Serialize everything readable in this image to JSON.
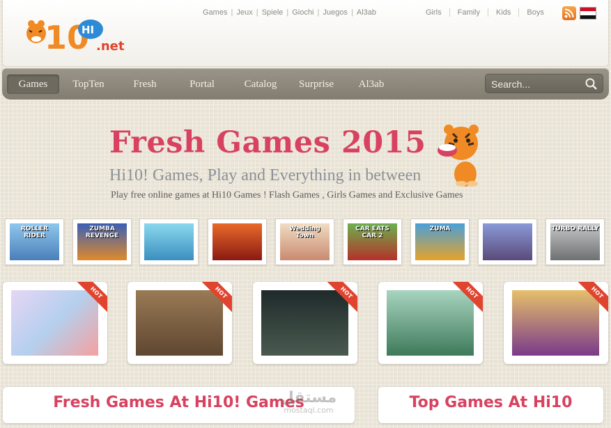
{
  "header": {
    "logo_text": "Hi10 HI .net",
    "languages": [
      "Games",
      "Jeux",
      "Spiele",
      "Giochi",
      "Juegos",
      "Al3ab"
    ],
    "categories": [
      "Girls",
      "Family",
      "Kids",
      "Boys"
    ],
    "rss_icon": "rss-icon",
    "flag_icon": "egypt-flag-icon"
  },
  "nav": {
    "items": [
      "Games",
      "TopTen",
      "Fresh",
      "Portal",
      "Catalog",
      "Surprise",
      "Al3ab"
    ],
    "active": "Games",
    "search_placeholder": "Search..."
  },
  "hero": {
    "title": "Fresh Games 2015",
    "subtitle": "Hi10! Games, Play and Everything in between",
    "description": "Play free online games at Hi10 Games ! Flash Games , Girls Games and Exclusive Games"
  },
  "thumbnails": [
    {
      "label": "ROLLER RIDER",
      "color": "#6aa7d8"
    },
    {
      "label": "ZUMBA REVENGE",
      "color": "#3a5fb5"
    },
    {
      "label": "",
      "color": "#68c4e0"
    },
    {
      "label": "",
      "color": "#c83b2a"
    },
    {
      "label": "Wedding Town",
      "color": "#e7c7a0"
    },
    {
      "label": "CAR EATS CAR 2",
      "color": "#4d8a3a"
    },
    {
      "label": "ZUMA",
      "color": "#2b6fb2"
    },
    {
      "label": "",
      "color": "#5a6aa0"
    },
    {
      "label": "TURBO RALLY",
      "color": "#9a9c9e"
    }
  ],
  "hot_cards": [
    {
      "ribbon": "HOT",
      "color": "#c9b6e2"
    },
    {
      "ribbon": "HOT",
      "color": "#8a6a46"
    },
    {
      "ribbon": "HOT",
      "color": "#2d3b34"
    },
    {
      "ribbon": "HOT",
      "color": "#6fa48a"
    },
    {
      "ribbon": "HOT",
      "color": "#c7a24f"
    }
  ],
  "panels": {
    "fresh": "Fresh Games At Hi10! Games",
    "top": "Top Games At Hi10"
  },
  "watermark": {
    "ar": "مستقل",
    "en": "mostaql.com"
  },
  "colors": {
    "accent": "#d8415f",
    "nav_bg": "#8c877b",
    "page_bg": "#e9e3d6"
  }
}
